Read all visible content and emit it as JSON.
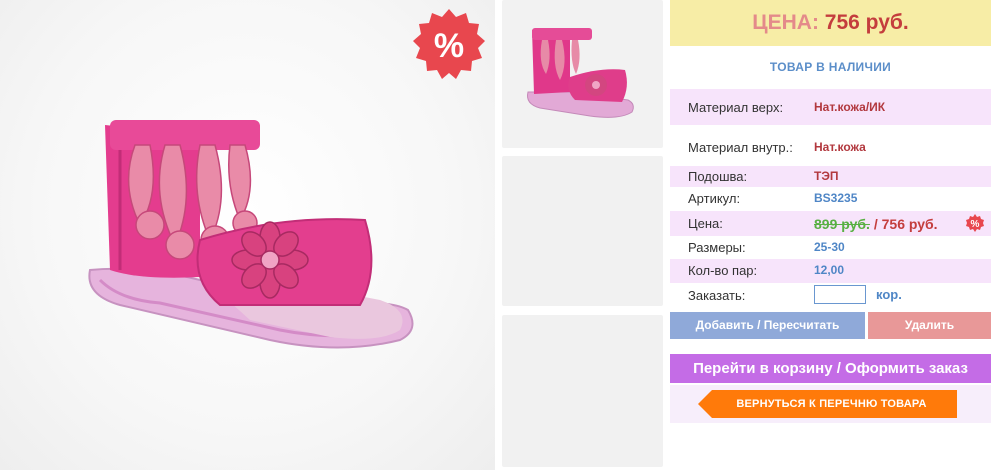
{
  "colors": {
    "accent_pink": "#c46ce6",
    "price_red": "#c43d3d",
    "stock_blue": "#5b8ec9",
    "sale_badge": "#e8474e",
    "back_button": "#ff7a0a"
  },
  "main_image": {
    "alt": "pink-girls-sandal",
    "badge_text": "%"
  },
  "thumbnails": [
    {
      "alt": "pink-sandal-thumbnail"
    },
    {
      "alt": "empty-thumbnail"
    },
    {
      "alt": "empty-thumbnail"
    }
  ],
  "price": {
    "label": "ЦЕНА:",
    "value": "756 руб."
  },
  "stock": "ТОВАР В НАЛИЧИИ",
  "specs": {
    "material_top": {
      "label": "Материал верх:",
      "value": "Нат.кожа/ИК"
    },
    "material_in": {
      "label": "Материал внутр.:",
      "value": "Нат.кожа"
    },
    "sole": {
      "label": "Подошва:",
      "value": "ТЭП"
    },
    "article": {
      "label": "Артикул:",
      "value": "BS3235"
    },
    "price": {
      "label": "Цена:",
      "old": "899 руб.",
      "separator": " / ",
      "new": "756 руб.",
      "badge": "%"
    },
    "sizes": {
      "label": "Размеры:",
      "value": "25-30"
    },
    "pairs": {
      "label": "Кол-во пар:",
      "value": "12,00"
    },
    "order": {
      "label": "Заказать:",
      "qty": "",
      "unit": "кор."
    }
  },
  "buttons": {
    "add": "Добавить / Пересчитать",
    "delete": "Удалить",
    "cart": "Перейти в корзину / Оформить заказ",
    "back": "ВЕРНУТЬСЯ К ПЕРЕЧНЮ ТОВАРА"
  }
}
